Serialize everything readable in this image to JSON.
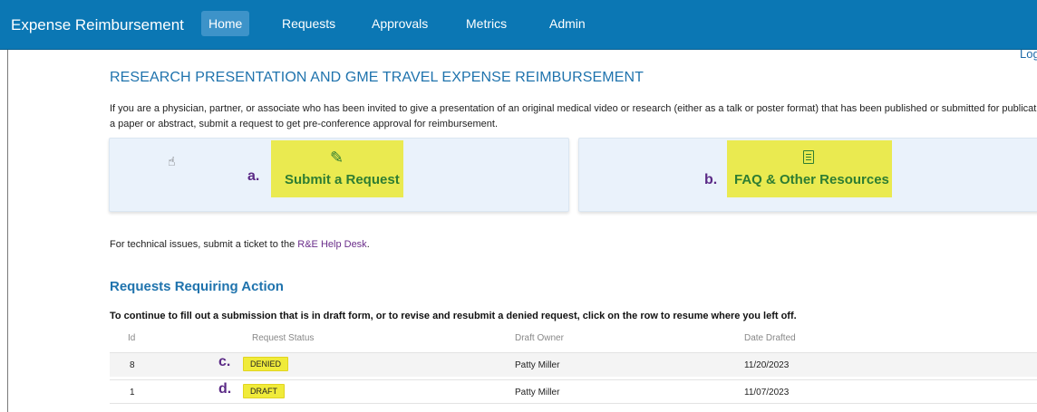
{
  "header": {
    "brand": "Expense Reimbursement",
    "nav": [
      "Home",
      "Requests",
      "Approvals",
      "Metrics",
      "Admin"
    ],
    "logout": "Log"
  },
  "main": {
    "title": "RESEARCH PRESENTATION AND GME TRAVEL EXPENSE REIMBURSEMENT",
    "intro": "If you are a physician, partner, or associate who has been invited to give a presentation of an original medical video or research (either as a talk or poster format) that has been published or submitted for publication as a paper or abstract, submit a request to get pre-conference approval for reimbursement.",
    "cards": [
      {
        "letter": "a.",
        "label": "Submit a Request",
        "icon": "pencil-icon"
      },
      {
        "letter": "b.",
        "label": "FAQ & Other Resources",
        "icon": "document-icon"
      }
    ],
    "tech_prefix": "For technical issues, submit a ticket to the ",
    "tech_link": "R&E Help Desk",
    "tech_suffix": "."
  },
  "requests": {
    "title": "Requests Requiring Action",
    "instructions": "To continue to fill out a submission that is in draft form, or to revise and resubmit a denied request, click on the row to resume where you left off.",
    "columns": [
      "Id",
      "Request Status",
      "Draft Owner",
      "Date Drafted"
    ],
    "rows": [
      {
        "letter": "c.",
        "id": "8",
        "status": "DENIED",
        "owner": "Patty Miller",
        "date": "11/20/2023"
      },
      {
        "letter": "d.",
        "id": "1",
        "status": "DRAFT",
        "owner": "Patty Miller",
        "date": "11/07/2023"
      }
    ]
  },
  "colors": {
    "nav_bar": "#0b77b4",
    "highlight": "#eaea50",
    "badge": "#f0eb3a",
    "card_bg": "#eaf2fb",
    "link_green": "#2e7d32",
    "title_blue": "#1f73ad"
  }
}
